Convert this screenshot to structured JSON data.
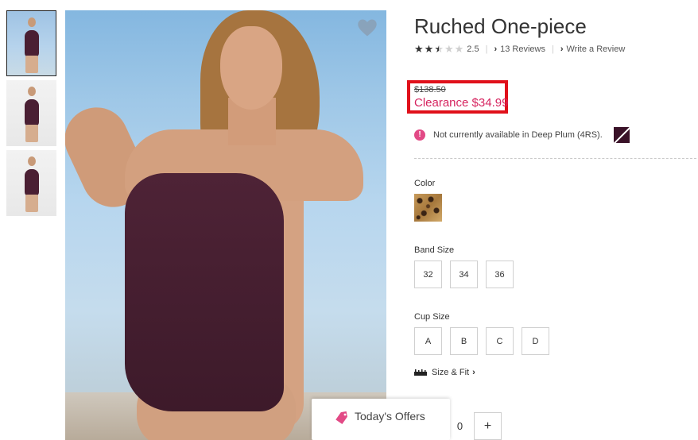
{
  "product": {
    "title": "Ruched One-piece",
    "rating": 2.5,
    "rating_text": "2.5",
    "reviews_link": "13 Reviews",
    "write_review_link": "Write a Review"
  },
  "price": {
    "was": "$138.50",
    "now": "Clearance $34.99"
  },
  "availability": {
    "notice": "Not currently available in Deep Plum (4RS)."
  },
  "options": {
    "color_label": "Color",
    "band_label": "Band Size",
    "band_sizes": [
      "32",
      "34",
      "36"
    ],
    "cup_label": "Cup Size",
    "cup_sizes": [
      "A",
      "B",
      "C",
      "D"
    ],
    "size_fit_link": "Size & Fit"
  },
  "quantity": {
    "value": "0",
    "plus": "+"
  },
  "offers": {
    "label": "Today's Offers"
  },
  "colors": {
    "sale": "#d6245f",
    "highlight_border": "#e0101a",
    "notice_icon": "#e24a86",
    "swatch_plum": "#3a1228"
  },
  "icons": {
    "favorite": "heart-icon",
    "notice": "exclamation-icon",
    "ruler": "ruler-icon",
    "offers": "tag-icon"
  }
}
